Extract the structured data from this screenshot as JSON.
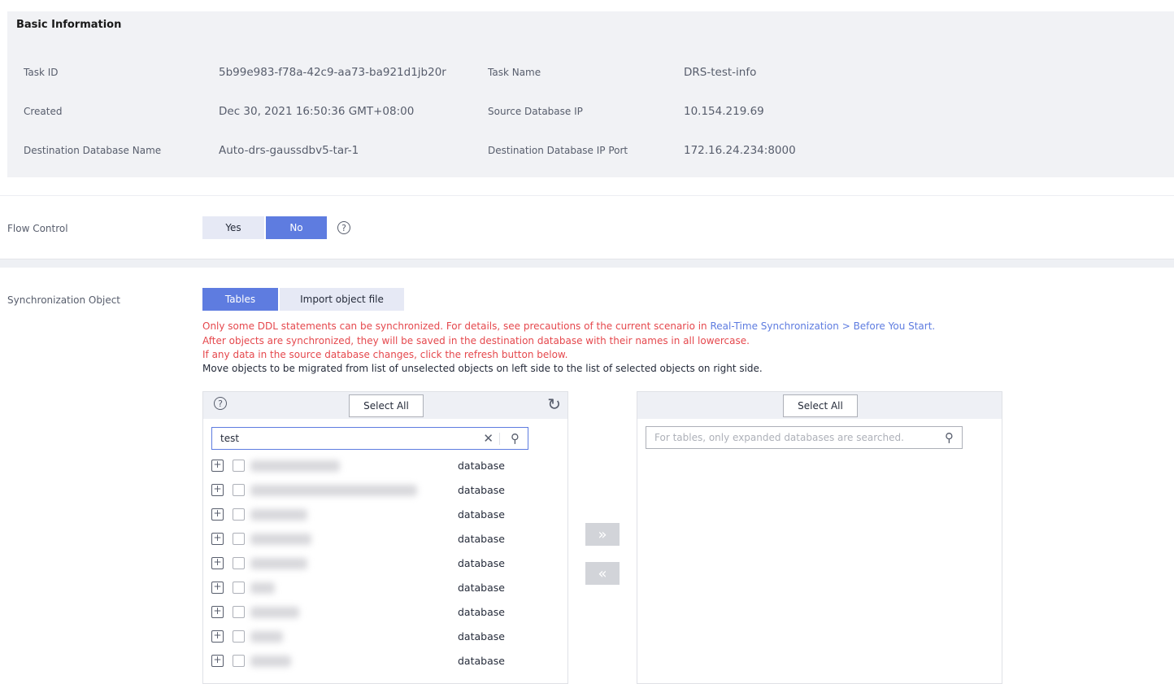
{
  "basic": {
    "title": "Basic Information",
    "fields": [
      {
        "label": "Task ID",
        "value": "5b99e983-f78a-42c9-aa73-ba921d1jb20r"
      },
      {
        "label": "Task Name",
        "value": "DRS-test-info"
      },
      {
        "label": "Created",
        "value": "Dec 30, 2021 16:50:36 GMT+08:00"
      },
      {
        "label": "Source Database IP",
        "value": "10.154.219.69"
      },
      {
        "label": "Destination Database Name",
        "value": "Auto-drs-gaussdbv5-tar-1"
      },
      {
        "label": "Destination Database IP Port",
        "value": "172.16.24.234:8000"
      }
    ]
  },
  "flow": {
    "label": "Flow Control",
    "yes": "Yes",
    "no": "No",
    "selected": "No"
  },
  "sync": {
    "label": "Synchronization Object",
    "tabs": [
      "Tables",
      "Import object file"
    ],
    "active_tab": "Tables",
    "msg1": "Only some DDL statements can be synchronized. For details, see precautions of the current scenario in ",
    "msg1_link": "Real-Time Synchronization > Before You Start.",
    "msg2": "After objects are synchronized, they will be saved in the destination database with their names in all lowercase.",
    "msg3": "If any data in the source database changes, click the refresh button below.",
    "msg4": "Move objects to be migrated from list of unselected objects on left side to the list of selected objects on right side."
  },
  "left": {
    "select_all": "Select All",
    "search_value": "test",
    "rows": [
      "database",
      "database",
      "database",
      "database",
      "database",
      "database",
      "database",
      "database",
      "database"
    ]
  },
  "right": {
    "select_all": "Select All",
    "search_placeholder": "For tables, only expanded databases are searched."
  },
  "colors": {
    "accent": "#5e7ce0",
    "warning": "#e5484d"
  }
}
